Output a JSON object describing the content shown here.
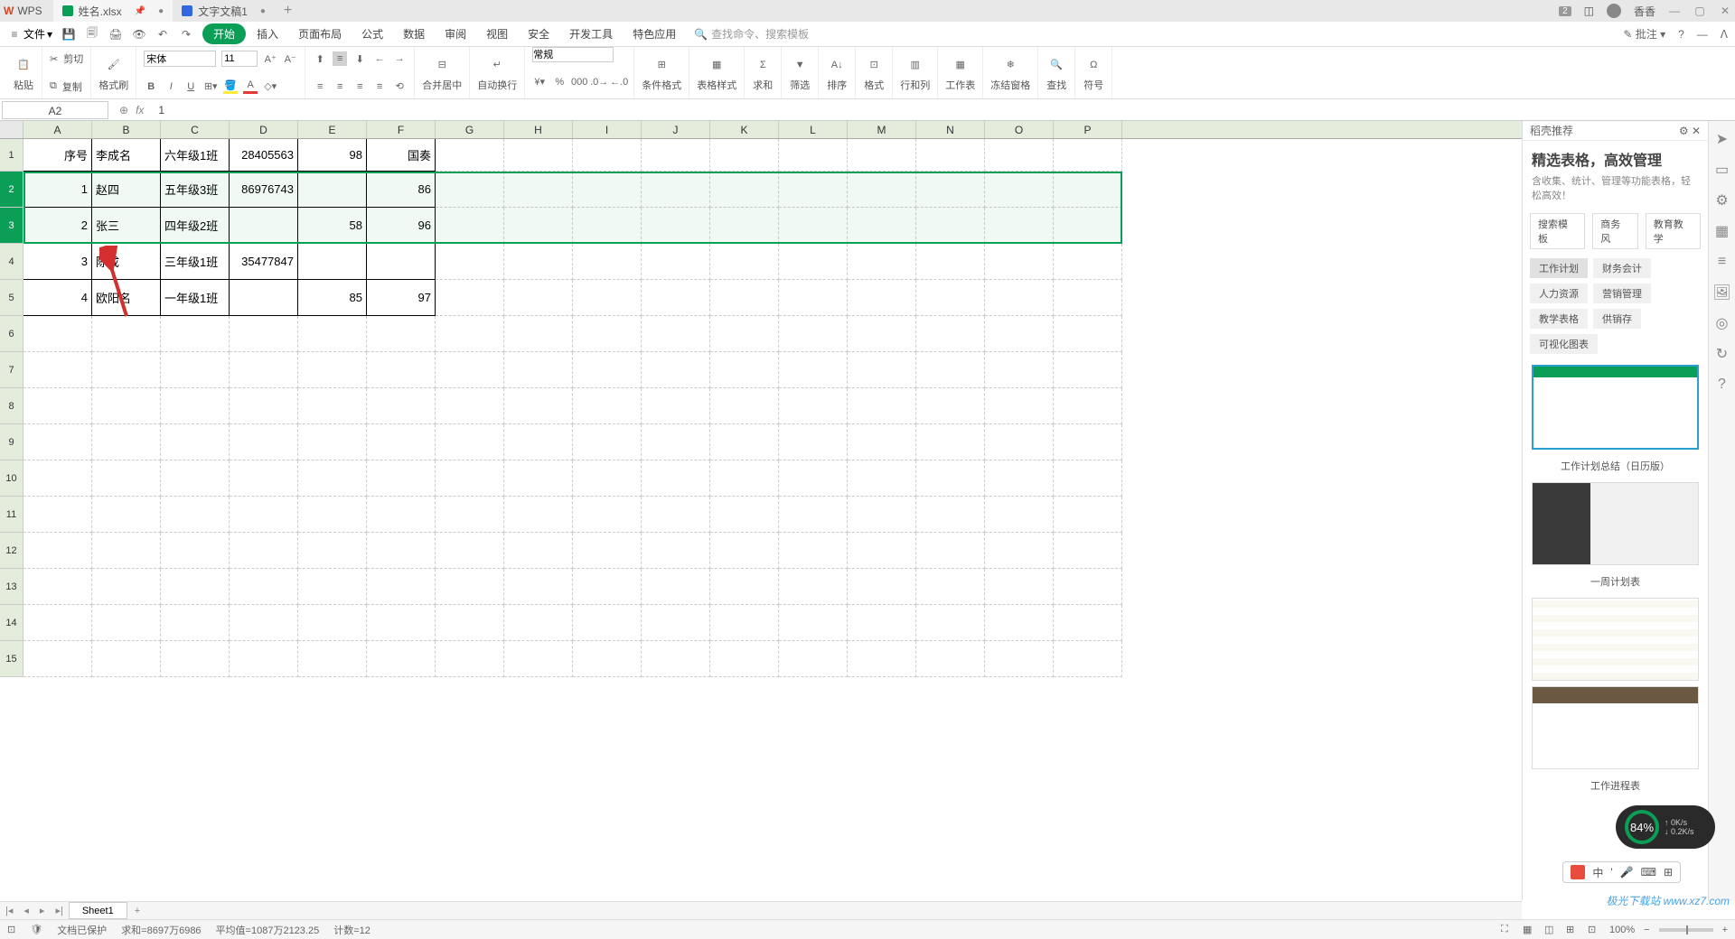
{
  "app": {
    "name": "WPS"
  },
  "tabs": [
    {
      "label": "姓名.xlsx",
      "active": true,
      "type": "s"
    },
    {
      "label": "文字文稿1",
      "active": false,
      "type": "w"
    }
  ],
  "user": {
    "name": "香香",
    "badge": "2"
  },
  "menu": {
    "file": "文件",
    "items": [
      "开始",
      "插入",
      "页面布局",
      "公式",
      "数据",
      "审阅",
      "视图",
      "安全",
      "开发工具",
      "特色应用"
    ],
    "search_placeholder": "查找命令、搜索模板",
    "annotate": "批注"
  },
  "ribbon": {
    "paste": "粘贴",
    "cut": "剪切",
    "copy": "复制",
    "format_painter": "格式刷",
    "font": "宋体",
    "font_size": "11",
    "merge": "合并居中",
    "wrap": "自动换行",
    "num_format": "常规",
    "cond_fmt": "条件格式",
    "tbl_style": "表格样式",
    "sum": "求和",
    "filter": "筛选",
    "sort": "排序",
    "format": "格式",
    "rowcol": "行和列",
    "worksheet": "工作表",
    "freeze": "冻结窗格",
    "find": "查找",
    "symbol": "符号"
  },
  "formula": {
    "name_box": "A2",
    "value": "1"
  },
  "columns": [
    "A",
    "B",
    "C",
    "D",
    "E",
    "F",
    "G",
    "H",
    "I",
    "J",
    "K",
    "L",
    "M",
    "N",
    "O",
    "P"
  ],
  "spreadsheet": {
    "header_row": {
      "num": "1",
      "A": "序号",
      "B": "李成名",
      "C": "六年级1班",
      "D": "28405563",
      "E": "98",
      "F": "国奏"
    },
    "rows": [
      {
        "num": "2",
        "A": "1",
        "B": "赵四",
        "C": "五年级3班",
        "D": "86976743",
        "E": "",
        "F": "86"
      },
      {
        "num": "3",
        "A": "2",
        "B": "张三",
        "C": "四年级2班",
        "D": "",
        "E": "58",
        "F": "96"
      },
      {
        "num": "4",
        "A": "3",
        "B": "陈成",
        "C": "三年级1班",
        "D": "35477847",
        "E": "",
        "F": ""
      },
      {
        "num": "5",
        "A": "4",
        "B": "欧阳名",
        "C": "一年级1班",
        "D": "",
        "E": "85",
        "F": "97"
      }
    ],
    "empty_rows": [
      "6",
      "7",
      "8",
      "9",
      "10",
      "11",
      "12",
      "13",
      "14",
      "15"
    ]
  },
  "right_panel": {
    "header": "稻壳推荐",
    "title": "精选表格，高效管理",
    "subtitle": "含收集、统计、管理等功能表格，轻松高效！",
    "search": "搜索模板",
    "tabs": [
      "商务风",
      "教育教学"
    ],
    "tags": [
      "工作计划",
      "财务会计",
      "人力资源",
      "营销管理",
      "教学表格",
      "供销存",
      "可视化图表"
    ],
    "templates": [
      "工作计划总结（日历版）",
      "一周计划表",
      "工作进程表"
    ]
  },
  "sheet_tabs": {
    "active": "Sheet1"
  },
  "status": {
    "protected": "文档已保护",
    "sum": "求和=8697万6986",
    "avg": "平均值=1087万2123.25",
    "count": "计数=12",
    "zoom": "100%"
  },
  "gauge": {
    "pct": "84%",
    "up": "0K/s",
    "down": "0.2K/s"
  },
  "ime": {
    "lang": "中",
    "items": [
      "中",
      "'",
      "",
      "",
      ""
    ]
  },
  "watermark": "极光下载站 www.xz7.com"
}
